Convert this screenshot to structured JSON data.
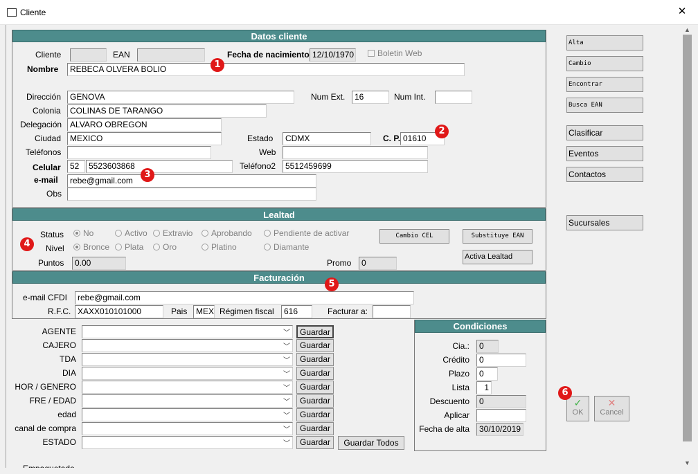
{
  "window": {
    "title": "Cliente",
    "close": "✕"
  },
  "colors": {
    "header_bg": "#4d8c8c",
    "badge": "#e01818"
  },
  "icons": {
    "app": "window-icon",
    "close": "close-icon",
    "ok": "check-icon",
    "cancel": "cross-icon"
  },
  "badges": [
    "1",
    "2",
    "3",
    "4",
    "5",
    "6"
  ],
  "datos": {
    "header": "Datos cliente",
    "cliente_label": "Cliente",
    "cliente_value": "",
    "ean_label": "EAN",
    "ean_value": "",
    "fecha_nac_label": "Fecha de nacimiento",
    "fecha_nac_value": "12/10/1970",
    "boletin_label": "Boletin Web",
    "nombre_label": "Nombre",
    "nombre_value": "REBECA OLVERA BOLIO",
    "direccion_label": "Dirección",
    "direccion_value": "GENOVA",
    "num_ext_label": "Num Ext.",
    "num_ext_value": "16",
    "num_int_label": "Num Int.",
    "num_int_value": "",
    "colonia_label": "Colonia",
    "colonia_value": "COLINAS DE TARANGO",
    "delegacion_label": "Delegación",
    "delegacion_value": "ALVARO OBREGON",
    "ciudad_label": "Ciudad",
    "ciudad_value": "MEXICO",
    "estado_label": "Estado",
    "estado_value": "CDMX",
    "cp_label": "C. P.",
    "cp_value": "01610",
    "telefonos_label": "Teléfonos",
    "telefonos_value": "",
    "web_label": "Web",
    "web_value": "",
    "celular_label": "Celular",
    "celular_lada": "52",
    "celular_value": "5523603868",
    "telefono2_label": "Teléfono2",
    "telefono2_value": "5512459699",
    "email_label": "e-mail",
    "email_value": "rebe@gmail.com",
    "obs_label": "Obs",
    "obs_value": ""
  },
  "lealtad": {
    "header": "Lealtad",
    "status_label": "Status",
    "status_options": [
      "No",
      "Activo",
      "Extravio",
      "Aprobando",
      "Pendiente de activar"
    ],
    "nivel_label": "Nivel",
    "nivel_options": [
      "Bronce",
      "Plata",
      "Oro",
      "Platino",
      "Diamante"
    ],
    "puntos_label": "Puntos",
    "puntos_value": "0.00",
    "promo_label": "Promo",
    "promo_value": "0",
    "cambio_cel": "Cambio CEL",
    "substituye_ean": "Substituye EAN",
    "activa_lealtad": "Activa Lealtad"
  },
  "facturacion": {
    "header": "Facturación",
    "email_cfdi_label": "e-mail  CFDI",
    "email_cfdi_value": "rebe@gmail.com",
    "rfc_label": "R.F.C.",
    "rfc_value": "XAXX010101000",
    "pais_label": "Pais",
    "pais_value": "MEX",
    "regimen_label": "Régimen fiscal",
    "regimen_value": "616",
    "facturar_label": "Facturar a:",
    "facturar_value": ""
  },
  "segmentos": {
    "rows": [
      {
        "label": "AGENTE",
        "value": "",
        "button": "Guardar"
      },
      {
        "label": "CAJERO",
        "value": "",
        "button": "Guardar"
      },
      {
        "label": "TDA",
        "value": "",
        "button": "Guardar"
      },
      {
        "label": "DIA",
        "value": "",
        "button": "Guardar"
      },
      {
        "label": "HOR / GENERO",
        "value": "",
        "button": "Guardar"
      },
      {
        "label": "FRE / EDAD",
        "value": "",
        "button": "Guardar"
      },
      {
        "label": "edad",
        "value": "",
        "button": "Guardar"
      },
      {
        "label": "canal de compra",
        "value": "",
        "button": "Guardar"
      },
      {
        "label": "ESTADO",
        "value": "",
        "button": "Guardar"
      }
    ],
    "guardar_todos": "Guardar Todos",
    "cut_label": "Empaquetado"
  },
  "condiciones": {
    "header": "Condiciones",
    "cia_label": "Cia.:",
    "cia_value": "0",
    "credito_label": "Crédito",
    "credito_value": "0",
    "plazo_label": "Plazo",
    "plazo_value": "0",
    "lista_label": "Lista",
    "lista_value": "1",
    "descuento_label": "Descuento",
    "descuento_value": "0",
    "aplicar_label": "Aplicar",
    "aplicar_value": "",
    "fecha_alta_label": "Fecha de alta",
    "fecha_alta_value": "30/10/2019"
  },
  "side": {
    "alta": "Alta",
    "cambio": "Cambio",
    "encontrar": "Encontrar",
    "busca_ean": "Busca EAN",
    "clasificar": "Clasificar",
    "eventos": "Eventos",
    "contactos": "Contactos",
    "sucursales": "Sucursales",
    "ok": "OK",
    "cancel": "Cancel"
  }
}
